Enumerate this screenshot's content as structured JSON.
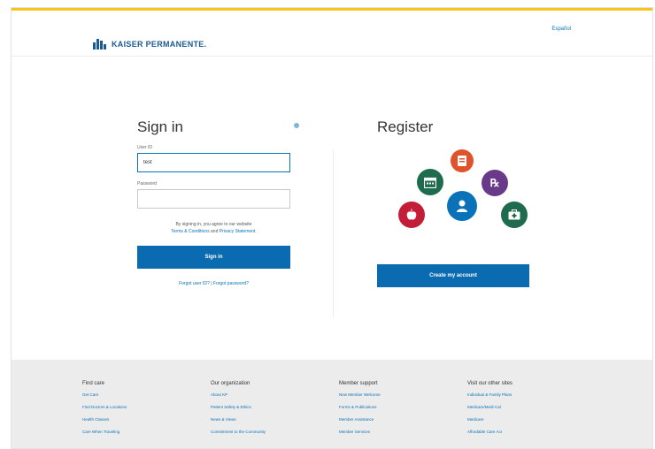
{
  "header": {
    "logo_text": "KAISER PERMANENTE.",
    "language_link": "Español"
  },
  "signin": {
    "title": "Sign in",
    "user_id_label": "User ID",
    "user_id_value": "test",
    "password_label": "Password",
    "password_value": "",
    "terms_line1": "By signing in, you agree to our website",
    "terms_link": "Terms & Conditions",
    "terms_and": " and ",
    "privacy_link": "Privacy Statement",
    "terms_end": ".",
    "button_label": "Sign in",
    "forgot_user_id": "Forgot user ID?",
    "forgot_separator": " | ",
    "forgot_password": "Forgot password?"
  },
  "register": {
    "title": "Register",
    "button_label": "Create my account",
    "icons": [
      {
        "name": "clipboard-icon",
        "color": "#e0532a"
      },
      {
        "name": "calendar-icon",
        "color": "#1f6b4d"
      },
      {
        "name": "rx-icon",
        "color": "#6a3a8a"
      },
      {
        "name": "person-icon",
        "color": "#0a72b8"
      },
      {
        "name": "apple-icon",
        "color": "#c41d3a"
      },
      {
        "name": "first-aid-icon",
        "color": "#1f6b4d"
      }
    ]
  },
  "footer": {
    "columns": [
      {
        "heading": "Find care",
        "links": [
          "Get Care",
          "Find Doctors & Locations",
          "Health Classes",
          "Care When Traveling"
        ]
      },
      {
        "heading": "Our organization",
        "links": [
          "About KP",
          "Patient Safety & Ethics",
          "News & Views",
          "Commitment to the Community"
        ]
      },
      {
        "heading": "Member support",
        "links": [
          "New Member Welcome",
          "Forms & Publications",
          "Member Assistance",
          "Member Services"
        ]
      },
      {
        "heading": "Visit our other sites",
        "links": [
          "Individual & Family Plans",
          "Medicare/Medi-Cal",
          "Medicare",
          "Affordable Care Act"
        ]
      }
    ]
  }
}
